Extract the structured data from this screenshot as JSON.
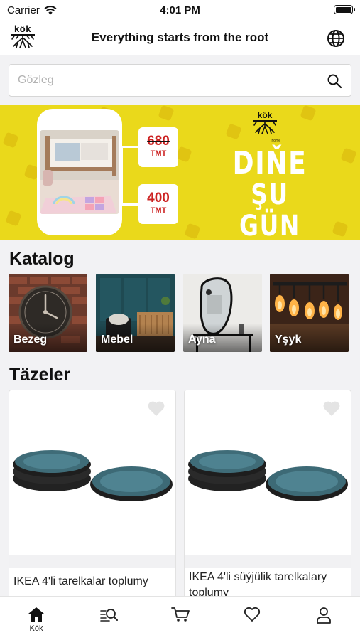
{
  "status_bar": {
    "carrier": "Carrier",
    "time": "4:01 PM"
  },
  "header": {
    "logo_text": "kök",
    "title": "Everything starts from the root"
  },
  "search": {
    "placeholder": "Gözleg"
  },
  "banner": {
    "old_price": "680",
    "old_currency": "TMT",
    "new_price": "400",
    "new_currency": "TMT",
    "promo_line1": "DIŇE",
    "promo_line2": "ŞU GÜN",
    "logo_text": "kök",
    "logo_sub": "home",
    "accent": "#ead91b"
  },
  "catalog": {
    "title": "Katalog",
    "items": [
      {
        "label": "Bezeg"
      },
      {
        "label": "Mebel"
      },
      {
        "label": "Ayna"
      },
      {
        "label": "Yşyk"
      }
    ]
  },
  "fresh": {
    "title": "Täzeler",
    "products": [
      {
        "name": "IKEA 4'li tarelkalar toplumy",
        "favorite": false
      },
      {
        "name": "IKEA 4'li süýjülik tarelkalary toplumy",
        "favorite": false
      }
    ]
  },
  "tabbar": {
    "items": [
      {
        "label": "Kök",
        "icon": "home-icon",
        "active": true
      },
      {
        "label": "",
        "icon": "search-list-icon",
        "active": false
      },
      {
        "label": "",
        "icon": "cart-icon",
        "active": false
      },
      {
        "label": "",
        "icon": "heart-icon",
        "active": false
      },
      {
        "label": "",
        "icon": "user-icon",
        "active": false
      }
    ]
  }
}
